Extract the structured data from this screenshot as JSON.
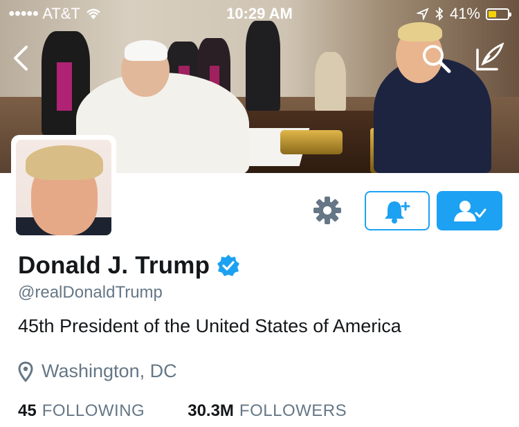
{
  "status_bar": {
    "signal_dots": "●●●●●",
    "carrier": "AT&T",
    "time": "10:29 AM",
    "battery": "41%",
    "battery_level": 0.41
  },
  "nav": {
    "back_icon": "chevron-left-icon",
    "search_icon": "search-icon",
    "compose_icon": "compose-tweet-icon"
  },
  "profile": {
    "name": "Donald J. Trump",
    "verified": true,
    "handle": "@realDonaldTrump",
    "bio": "45th President of the United States of America",
    "location": "Washington, DC",
    "stats": {
      "following_count": "45",
      "following_label": "FOLLOWING",
      "followers_count": "30.3M",
      "followers_label": "FOLLOWERS"
    }
  },
  "actions": {
    "settings_icon": "gear-icon",
    "notify_icon": "bell-plus-icon",
    "following_icon": "person-check-icon"
  },
  "colors": {
    "accent": "#1da1f2",
    "text_primary": "#14171a",
    "text_secondary": "#657786"
  }
}
